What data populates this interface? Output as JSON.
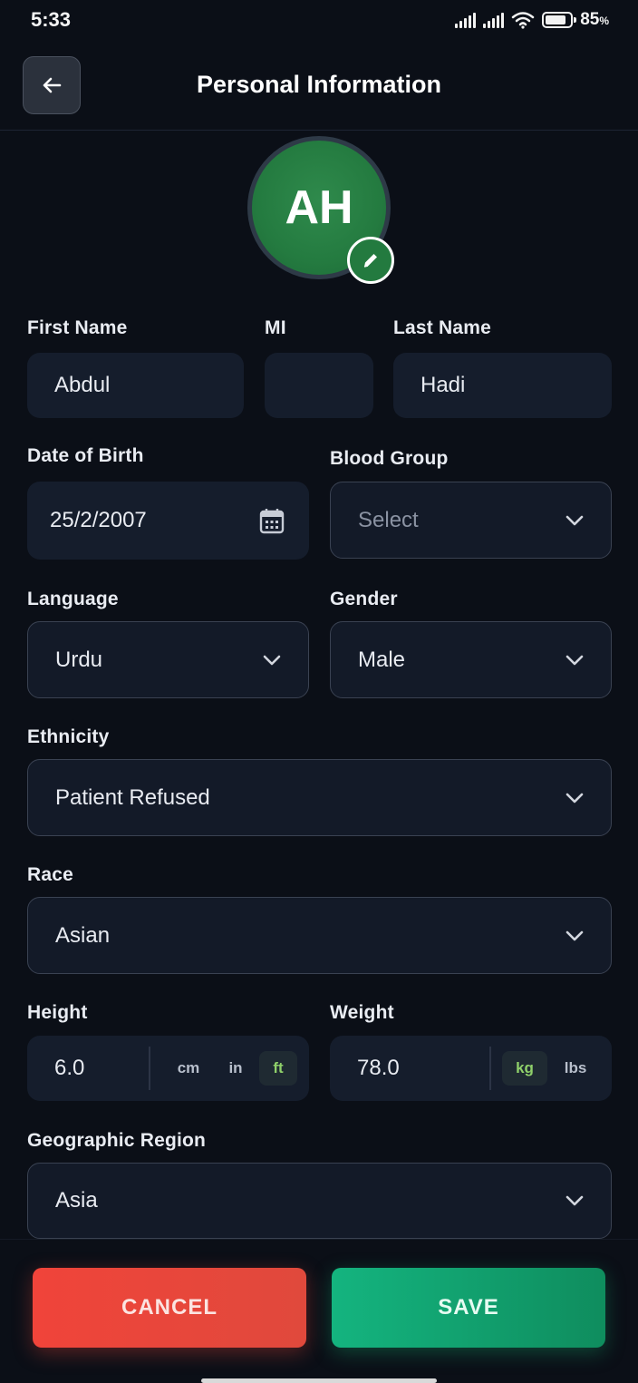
{
  "status_bar": {
    "time": "5:33",
    "battery_percent": "85",
    "battery_suffix": "%"
  },
  "header": {
    "title": "Personal Information"
  },
  "avatar": {
    "initials": "AH",
    "color": "#247b40"
  },
  "form": {
    "first_name": {
      "label": "First Name",
      "value": "Abdul"
    },
    "middle_initial": {
      "label": "MI",
      "value": ""
    },
    "last_name": {
      "label": "Last Name",
      "value": "Hadi"
    },
    "date_of_birth": {
      "label": "Date of Birth",
      "value": "25/2/2007"
    },
    "blood_group": {
      "label": "Blood Group",
      "value": "Select"
    },
    "language": {
      "label": "Language",
      "value": "Urdu"
    },
    "gender": {
      "label": "Gender",
      "value": "Male"
    },
    "ethnicity": {
      "label": "Ethnicity",
      "value": "Patient Refused"
    },
    "race": {
      "label": "Race",
      "value": "Asian"
    },
    "height": {
      "label": "Height",
      "value": "6.0",
      "units": [
        "cm",
        "in",
        "ft"
      ],
      "selected_unit": "ft"
    },
    "weight": {
      "label": "Weight",
      "value": "78.0",
      "units": [
        "kg",
        "lbs"
      ],
      "selected_unit": "kg"
    },
    "geographic_region": {
      "label": "Geographic Region",
      "value": "Asia"
    }
  },
  "actions": {
    "cancel_label": "CANCEL",
    "save_label": "SAVE"
  },
  "colors": {
    "cancel": "#f0443a",
    "save": "#14b47f",
    "active_unit": "#8fd06a"
  }
}
